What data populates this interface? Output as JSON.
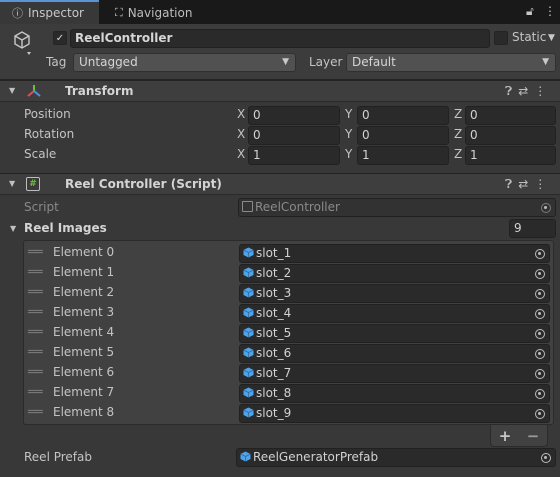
{
  "tabs": [
    {
      "label": "Inspector",
      "icon": "info-icon"
    },
    {
      "label": "Navigation",
      "icon": "navigation-icon"
    }
  ],
  "header": {
    "active": "✓",
    "name": "ReelController",
    "static_label": "Static",
    "tag_label": "Tag",
    "tag_value": "Untagged",
    "layer_label": "Layer",
    "layer_value": "Default"
  },
  "transform": {
    "title": "Transform",
    "rows": [
      {
        "label": "Position",
        "x": "0",
        "y": "0",
        "z": "0"
      },
      {
        "label": "Rotation",
        "x": "0",
        "y": "0",
        "z": "0"
      },
      {
        "label": "Scale",
        "x": "1",
        "y": "1",
        "z": "1"
      }
    ],
    "axes": [
      "X",
      "Y",
      "Z"
    ]
  },
  "script_component": {
    "title": "Reel Controller (Script)",
    "script_label": "Script",
    "script_value": "ReelController",
    "reel_images_label": "Reel Images",
    "reel_images_count": "9",
    "elements": [
      {
        "label": "Element 0",
        "value": "slot_1"
      },
      {
        "label": "Element 1",
        "value": "slot_2"
      },
      {
        "label": "Element 2",
        "value": "slot_3"
      },
      {
        "label": "Element 3",
        "value": "slot_4"
      },
      {
        "label": "Element 4",
        "value": "slot_5"
      },
      {
        "label": "Element 5",
        "value": "slot_6"
      },
      {
        "label": "Element 6",
        "value": "slot_7"
      },
      {
        "label": "Element 7",
        "value": "slot_8"
      },
      {
        "label": "Element 8",
        "value": "slot_9"
      }
    ],
    "add_label": "+",
    "remove_label": "−",
    "reel_prefab_label": "Reel Prefab",
    "reel_prefab_value": "ReelGeneratorPrefab"
  },
  "colors": {
    "accent": "#5c93d6",
    "prefab_icon": "#4fa3e8",
    "background": "#383838"
  }
}
